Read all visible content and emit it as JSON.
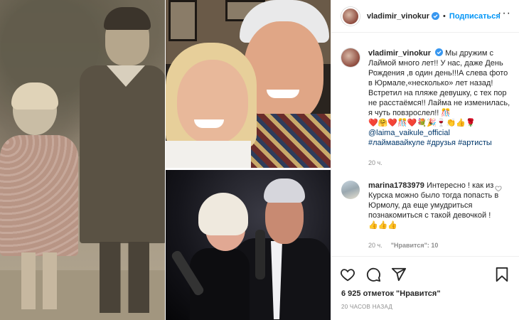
{
  "post": {
    "username": "vladimir_vinokur",
    "separator": "•",
    "follow_label": "Подписаться",
    "more_label": "···"
  },
  "caption": {
    "username": "vladimir_vinokur",
    "text": "Мы дружим с Лаймой много лет!! У нас, даже День Рождения ,в один день!!!А слева фото в Юрмале,«несколько» лет назад! Встретил на пляже девушку, с тех пор не расстаёмся!! Лайма не изменилась, я чуть повзрослел!! 🎊",
    "emojis": "❤️🤗❤️🎊❤️💐🎉🍷👏👍🌹",
    "mention": "@laima_vaikule_official",
    "hashtags": "#лаймавайкуле #друзья #артисты",
    "time": "20 ч."
  },
  "comment": {
    "username": "marina1783979",
    "text": "Интересно ! как из Курска можно было тогда попасть в Юрмолу, да еще умудриться познакомиться с такой девочкой ! 👍👍👍",
    "time": "20 ч.",
    "likes_label": "\"Нравится\": 10"
  },
  "footer": {
    "likes": "6 925 отметок \"Нравится\"",
    "timestamp": "20 часов назад"
  },
  "icons": {
    "verified": "verified-badge-icon",
    "like": "heart-icon",
    "comment": "comment-icon",
    "share": "share-icon",
    "save": "bookmark-icon",
    "comment_like": "small-heart-icon"
  },
  "colors": {
    "accent": "#0095f6",
    "link": "#00376b",
    "muted": "#8e8e8e",
    "text": "#262626"
  }
}
